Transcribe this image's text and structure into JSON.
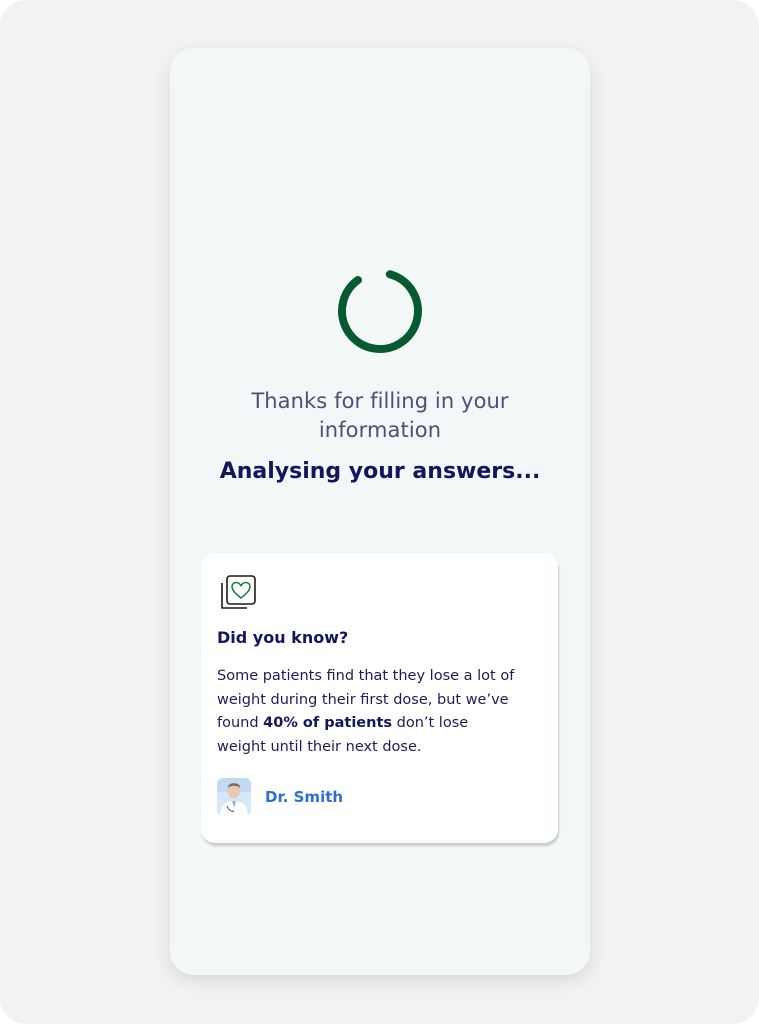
{
  "loading": {
    "thanks_line1": "Thanks for filling in your",
    "thanks_line2": "information",
    "status": "Analysing your answers..."
  },
  "card": {
    "icon": "heart-cards-icon",
    "title": "Did you know?",
    "body_before": "Some patients find that they lose a lot of weight during their first dose, but we’ve found ",
    "body_bold": "40% of patients",
    "body_after": " don’t lose weight until their next dose.",
    "author": "Dr. Smith"
  },
  "colors": {
    "spinner": "#075a30",
    "heading": "#13165c",
    "link": "#2e6fd1",
    "background": "#f1f8f7"
  }
}
